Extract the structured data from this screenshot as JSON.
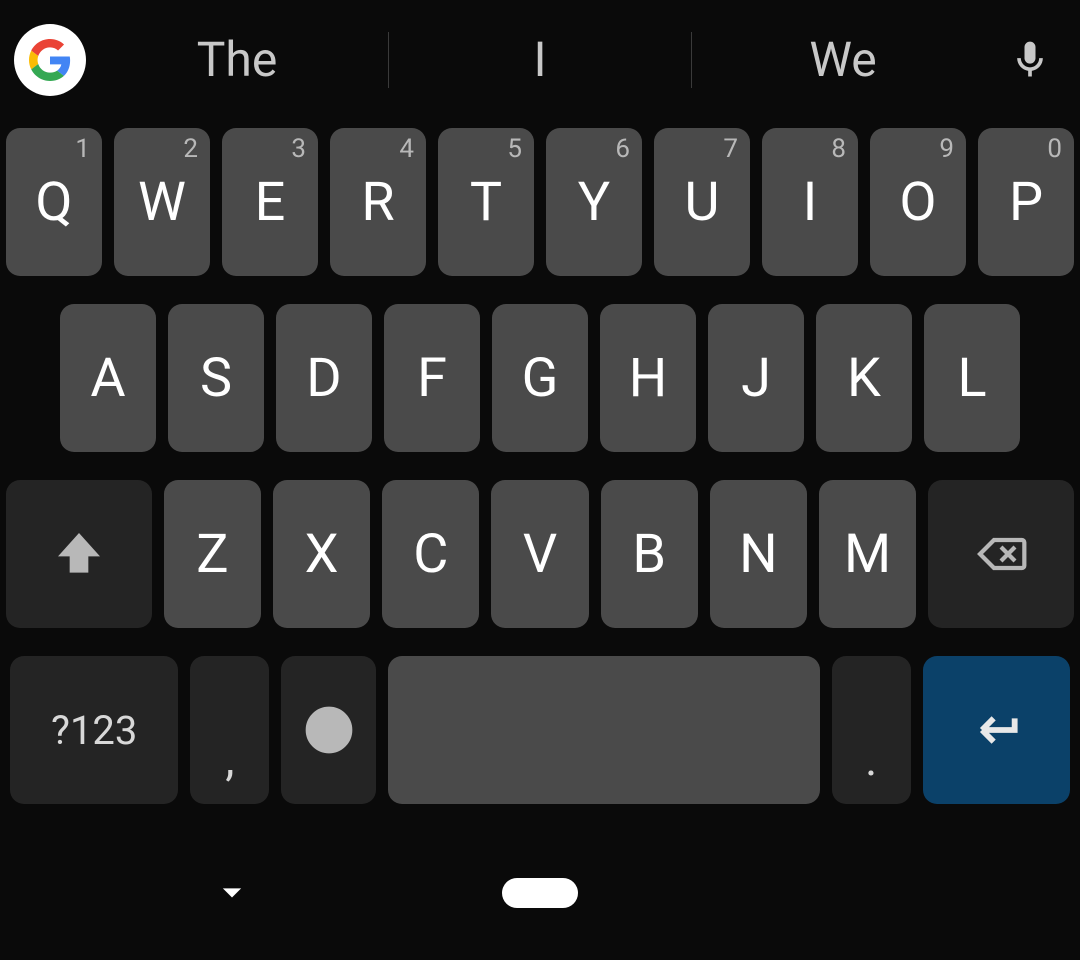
{
  "suggestions": [
    "The",
    "I",
    "We"
  ],
  "rows": {
    "r1": [
      {
        "l": "Q",
        "h": "1"
      },
      {
        "l": "W",
        "h": "2"
      },
      {
        "l": "E",
        "h": "3"
      },
      {
        "l": "R",
        "h": "4"
      },
      {
        "l": "T",
        "h": "5"
      },
      {
        "l": "Y",
        "h": "6"
      },
      {
        "l": "U",
        "h": "7"
      },
      {
        "l": "I",
        "h": "8"
      },
      {
        "l": "O",
        "h": "9"
      },
      {
        "l": "P",
        "h": "0"
      }
    ],
    "r2": [
      "A",
      "S",
      "D",
      "F",
      "G",
      "H",
      "J",
      "K",
      "L"
    ],
    "r3": [
      "Z",
      "X",
      "C",
      "V",
      "B",
      "N",
      "M"
    ]
  },
  "bottom": {
    "symbols": "?123",
    "comma": ",",
    "period": "."
  }
}
